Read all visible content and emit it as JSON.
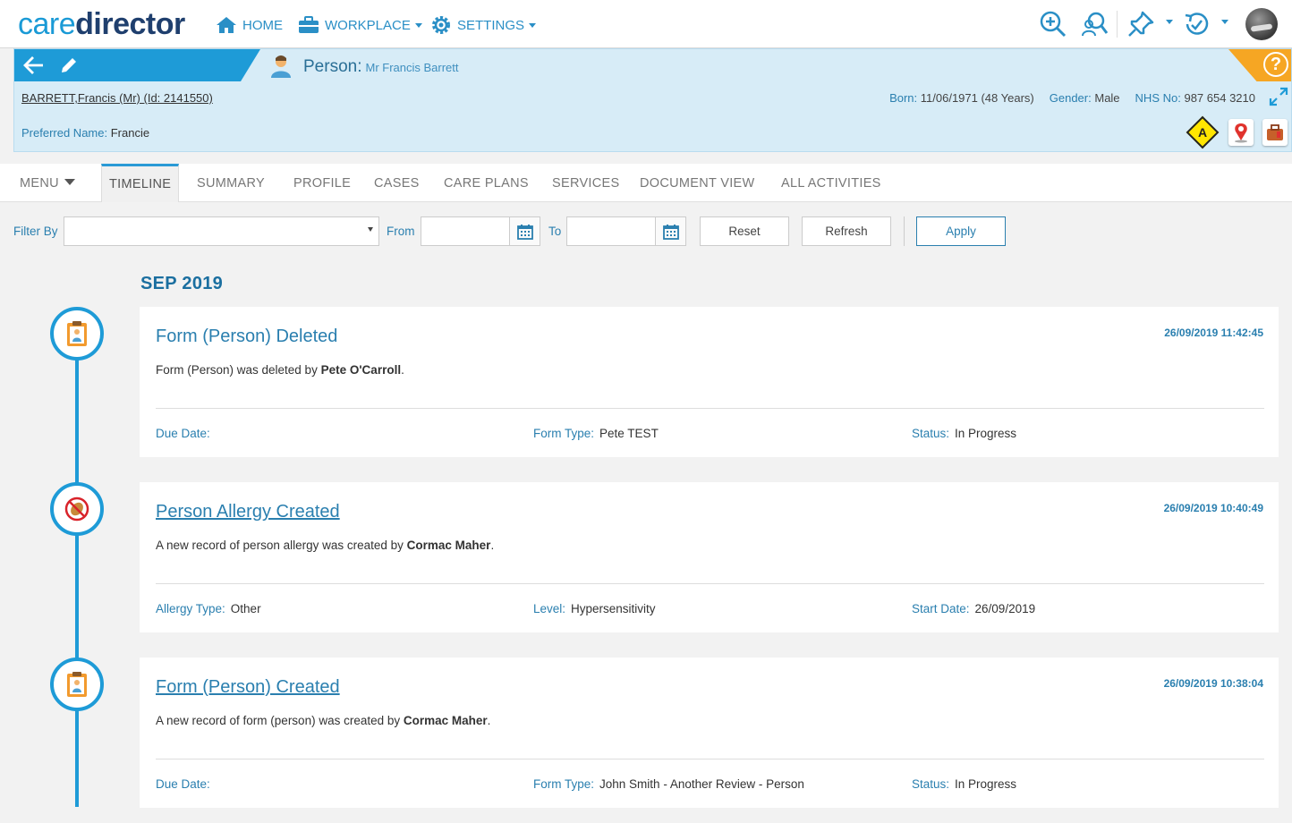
{
  "logo": {
    "part1": "care",
    "part2": "director"
  },
  "nav": {
    "home": "HOME",
    "workplace": "WORKPLACE",
    "settings": "SETTINGS"
  },
  "toolbar_icons": [
    "zoom-search-icon",
    "advanced-search-icon",
    "pin-icon",
    "recent-history-icon"
  ],
  "person_header": {
    "title_label": "Person:",
    "title_name": "Mr Francis Barrett",
    "id_line": "BARRETT,Francis (Mr) (Id: 2141550)",
    "born_label": "Born:",
    "born_value": "11/06/1971 (48 Years)",
    "gender_label": "Gender:",
    "gender_value": "Male",
    "nhs_label": "NHS No:",
    "nhs_value": "987 654 3210",
    "preferred_label": "Preferred Name:",
    "preferred_value": "Francie",
    "alert_letter": "A",
    "help": "?"
  },
  "tabs": {
    "menu": "MENU",
    "items": [
      "TIMELINE",
      "SUMMARY",
      "PROFILE",
      "CASES",
      "CARE PLANS",
      "SERVICES",
      "DOCUMENT VIEW",
      "ALL ACTIVITIES"
    ]
  },
  "filter": {
    "filter_by_label": "Filter By",
    "from_label": "From",
    "to_label": "To",
    "reset": "Reset",
    "refresh": "Refresh",
    "apply": "Apply"
  },
  "timeline": {
    "month": "SEP 2019",
    "entries": [
      {
        "title": "Form (Person) Deleted",
        "date": "26/09/2019 11:42:45",
        "desc_text": "Form (Person) was deleted by ",
        "desc_user": "Pete O'Carroll",
        "desc_end": ".",
        "f1_label": "Due Date:",
        "f1_value": "",
        "f2_label": "Form Type:",
        "f2_value": "Pete TEST",
        "f3_label": "Status:",
        "f3_value": "In Progress"
      },
      {
        "title": "Person Allergy Created",
        "date": "26/09/2019 10:40:49",
        "desc_text": "A new record of person allergy was created by ",
        "desc_user": "Cormac Maher",
        "desc_end": ".",
        "f1_label": "Allergy Type:",
        "f1_value": "Other",
        "f2_label": "Level:",
        "f2_value": "Hypersensitivity",
        "f3_label": "Start Date:",
        "f3_value": "26/09/2019"
      },
      {
        "title": "Form (Person) Created",
        "date": "26/09/2019 10:38:04",
        "desc_text": "A new record of form (person) was created by ",
        "desc_user": "Cormac Maher",
        "desc_end": ".",
        "f1_label": "Due Date:",
        "f1_value": "",
        "f2_label": "Form Type:",
        "f2_value": "John Smith - Another Review - Person",
        "f3_label": "Status:",
        "f3_value": "In Progress"
      }
    ]
  },
  "colors": {
    "accent": "#1e9bd7",
    "header_bg": "#d7ecf7",
    "link": "#2a7faf",
    "warning": "#f6a623"
  }
}
